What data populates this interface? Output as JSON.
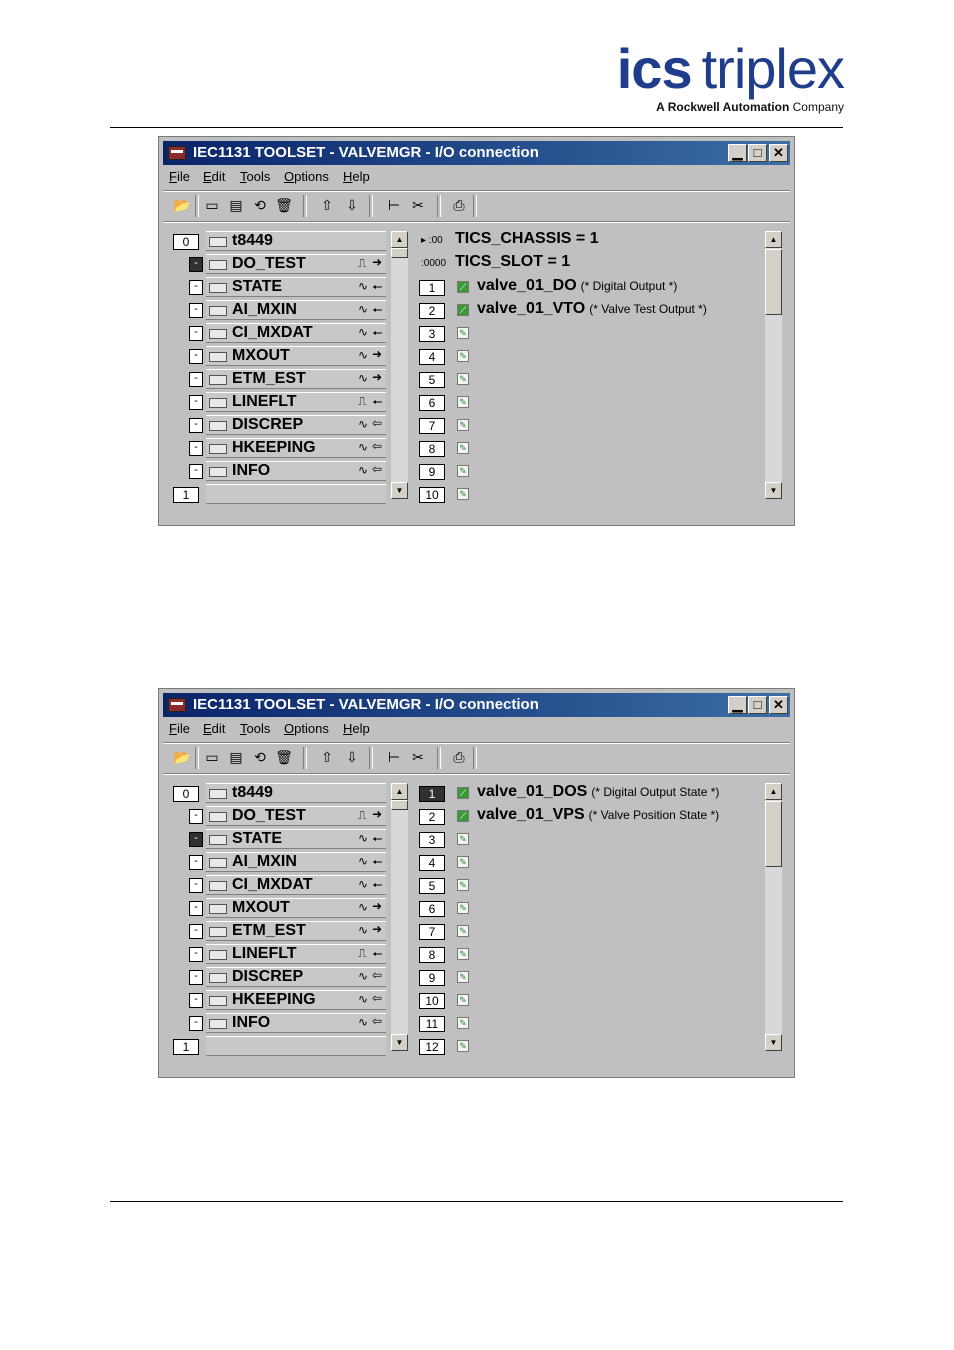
{
  "logo": {
    "main_a": "ics",
    "main_b": "triplex",
    "tag": "A Rockwell Automation",
    "tag_company": "Company"
  },
  "colors": {
    "logo_blue": "#1f3d8a",
    "titlebar": "#0a246a"
  },
  "windows": [
    {
      "title": "IEC1131 TOOLSET - VALVEMGR - I/O connection",
      "menu": [
        "File",
        "Edit",
        "Tools",
        "Options",
        "Help"
      ],
      "left": {
        "top_index": "0",
        "top_name": "t8449",
        "items": [
          {
            "mark": "-",
            "name": "DO_TEST",
            "kind": "⎍",
            "dir": "➜",
            "selected": true
          },
          {
            "mark": "-",
            "name": "STATE",
            "kind": "∿",
            "dir": "🠔",
            "selected": false
          },
          {
            "mark": "-",
            "name": "AI_MXIN",
            "kind": "∿",
            "dir": "🠔",
            "selected": false
          },
          {
            "mark": "-",
            "name": "CI_MXDAT",
            "kind": "∿",
            "dir": "🠔",
            "selected": false
          },
          {
            "mark": "-",
            "name": "MXOUT",
            "kind": "∿",
            "dir": "➜",
            "selected": false
          },
          {
            "mark": "-",
            "name": "ETM_EST",
            "kind": "∿",
            "dir": "➜",
            "selected": false
          },
          {
            "mark": "-",
            "name": "LINEFLT",
            "kind": "⎍",
            "dir": "🠔",
            "selected": false
          },
          {
            "mark": "-",
            "name": "DISCREP",
            "kind": "∿",
            "dir": "⇦",
            "selected": false
          },
          {
            "mark": "-",
            "name": "HKEEPING",
            "kind": "∿",
            "dir": "⇦",
            "selected": false
          },
          {
            "mark": "-",
            "name": "INFO",
            "kind": "∿",
            "dir": "⇦",
            "selected": false
          }
        ],
        "bottom_index": "1"
      },
      "right": {
        "headers": [
          {
            "icon": "▸ :00",
            "text": "TICS_CHASSIS = 1"
          },
          {
            "icon": ":0000",
            "text": "TICS_SLOT = 1"
          }
        ],
        "rows": [
          {
            "num": "1",
            "name": "valve_01_DO",
            "comment": "(* Digital Output *)",
            "dark": false,
            "on": true
          },
          {
            "num": "2",
            "name": "valve_01_VTO",
            "comment": "(* Valve Test Output *)",
            "dark": false,
            "on": true
          },
          {
            "num": "3",
            "name": "",
            "comment": "",
            "dark": false,
            "on": false
          },
          {
            "num": "4",
            "name": "",
            "comment": "",
            "dark": false,
            "on": false
          },
          {
            "num": "5",
            "name": "",
            "comment": "",
            "dark": false,
            "on": false
          },
          {
            "num": "6",
            "name": "",
            "comment": "",
            "dark": false,
            "on": false
          },
          {
            "num": "7",
            "name": "",
            "comment": "",
            "dark": false,
            "on": false
          },
          {
            "num": "8",
            "name": "",
            "comment": "",
            "dark": false,
            "on": false
          },
          {
            "num": "9",
            "name": "",
            "comment": "",
            "dark": false,
            "on": false
          },
          {
            "num": "10",
            "name": "",
            "comment": "",
            "dark": false,
            "on": false
          }
        ]
      }
    },
    {
      "title": "IEC1131 TOOLSET - VALVEMGR - I/O connection",
      "menu": [
        "File",
        "Edit",
        "Tools",
        "Options",
        "Help"
      ],
      "left": {
        "top_index": "0",
        "top_name": "t8449",
        "items": [
          {
            "mark": "-",
            "name": "DO_TEST",
            "kind": "⎍",
            "dir": "➜",
            "selected": false
          },
          {
            "mark": "-",
            "name": "STATE",
            "kind": "∿",
            "dir": "🠔",
            "selected": true
          },
          {
            "mark": "-",
            "name": "AI_MXIN",
            "kind": "∿",
            "dir": "🠔",
            "selected": false
          },
          {
            "mark": "-",
            "name": "CI_MXDAT",
            "kind": "∿",
            "dir": "🠔",
            "selected": false
          },
          {
            "mark": "-",
            "name": "MXOUT",
            "kind": "∿",
            "dir": "➜",
            "selected": false
          },
          {
            "mark": "-",
            "name": "ETM_EST",
            "kind": "∿",
            "dir": "➜",
            "selected": false
          },
          {
            "mark": "-",
            "name": "LINEFLT",
            "kind": "⎍",
            "dir": "🠔",
            "selected": false
          },
          {
            "mark": "-",
            "name": "DISCREP",
            "kind": "∿",
            "dir": "⇦",
            "selected": false
          },
          {
            "mark": "-",
            "name": "HKEEPING",
            "kind": "∿",
            "dir": "⇦",
            "selected": false
          },
          {
            "mark": "-",
            "name": "INFO",
            "kind": "∿",
            "dir": "⇦",
            "selected": false
          }
        ],
        "bottom_index": "1"
      },
      "right": {
        "headers": [],
        "rows": [
          {
            "num": "1",
            "name": "valve_01_DOS",
            "comment": "(* Digital Output State *)",
            "dark": true,
            "on": true
          },
          {
            "num": "2",
            "name": "valve_01_VPS",
            "comment": "(* Valve Position State *)",
            "dark": false,
            "on": true
          },
          {
            "num": "3",
            "name": "",
            "comment": "",
            "dark": false,
            "on": false
          },
          {
            "num": "4",
            "name": "",
            "comment": "",
            "dark": false,
            "on": false
          },
          {
            "num": "5",
            "name": "",
            "comment": "",
            "dark": false,
            "on": false
          },
          {
            "num": "6",
            "name": "",
            "comment": "",
            "dark": false,
            "on": false
          },
          {
            "num": "7",
            "name": "",
            "comment": "",
            "dark": false,
            "on": false
          },
          {
            "num": "8",
            "name": "",
            "comment": "",
            "dark": false,
            "on": false
          },
          {
            "num": "9",
            "name": "",
            "comment": "",
            "dark": false,
            "on": false
          },
          {
            "num": "10",
            "name": "",
            "comment": "",
            "dark": false,
            "on": false
          },
          {
            "num": "11",
            "name": "",
            "comment": "",
            "dark": false,
            "on": false
          },
          {
            "num": "12",
            "name": "",
            "comment": "",
            "dark": false,
            "on": false
          }
        ]
      }
    }
  ]
}
